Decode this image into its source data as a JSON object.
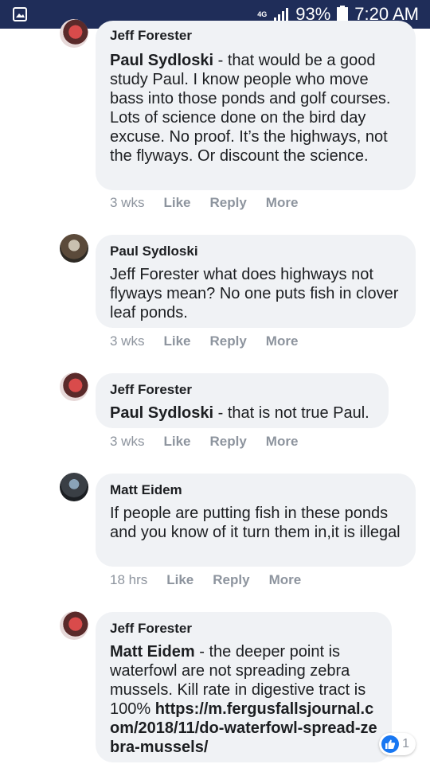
{
  "status_bar": {
    "network": "4G",
    "battery": "93%",
    "time": "7:20 AM"
  },
  "comments": [
    {
      "author": "Jeff Forester",
      "mention": "Paul Sydloski",
      "text": " - that would be a good study Paul. I know people who move bass into those ponds and golf courses. Lots of science done on the bird day excuse. No proof. It’s the highways, not the flyways. Or discount the science.",
      "time": "3 wks",
      "actions": [
        "Like",
        "Reply",
        "More"
      ]
    },
    {
      "author": "Paul Sydloski",
      "text": "Jeff Forester what does highways not flyways mean? No one puts fish in clover leaf ponds.",
      "time": "3 wks",
      "actions": [
        "Like",
        "Reply",
        "More"
      ]
    },
    {
      "author": "Jeff Forester",
      "mention": "Paul Sydloski",
      "text": " - that is not true Paul.",
      "time": "3 wks",
      "actions": [
        "Like",
        "Reply",
        "More"
      ]
    },
    {
      "author": "Matt Eidem",
      "text": "If people are putting fish in these ponds and you know of it turn them in,it is illegal",
      "time": "18 hrs",
      "actions": [
        "Like",
        "Reply",
        "More"
      ]
    },
    {
      "author": "Jeff Forester",
      "mention": "Matt Eidem",
      "text": " - the deeper point is waterfowl are not spreading zebra mussels. Kill rate in digestive tract is 100% ",
      "link": "https://m.fergusfallsjournal.com/2018/11/do-waterfowl-spread-zebra-mussels/",
      "reaction_count": "1"
    }
  ]
}
